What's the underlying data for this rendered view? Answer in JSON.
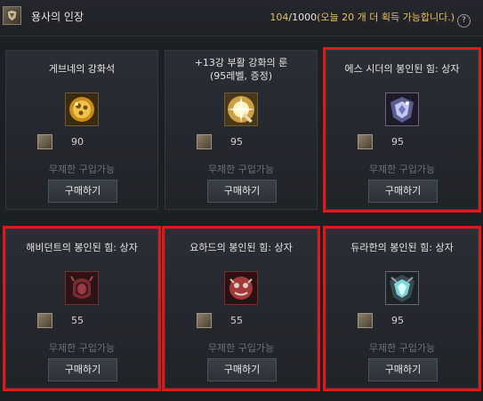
{
  "header": {
    "title": "용사의 인장",
    "count_current": "104",
    "count_max": "/1000",
    "count_note": "(오늘 20 개 더 획득 가능합니다.)",
    "help_label": "?"
  },
  "colors": {
    "highlight": "#e01818",
    "gold_text": "#e8c15a",
    "card_bg": "#26292f"
  },
  "items": [
    {
      "name": "게브네의 강화석",
      "icon": "golden-orb-icon",
      "price": "90",
      "availability": "무제한 구입가능",
      "buy_label": "구매하기",
      "highlighted": false
    },
    {
      "name_line1": "+13강 부활 강화의 룬",
      "name_line2": "(95레벨, 증정)",
      "icon": "radiant-rune-icon",
      "price": "95",
      "availability": "무제한 구입가능",
      "buy_label": "구매하기",
      "highlighted": false
    },
    {
      "name": "에스 시더의 봉인된 힘: 상자",
      "icon": "sealed-crest-icon",
      "price": "95",
      "availability": "무제한 구입가능",
      "buy_label": "구매하기",
      "highlighted": true
    },
    {
      "name": "해비던트의 봉인된 힘: 상자",
      "icon": "red-helm-icon",
      "price": "55",
      "availability": "무제한 구입가능",
      "buy_label": "구매하기",
      "highlighted": true
    },
    {
      "name": "요하드의 봉인된 힘: 상자",
      "icon": "demon-face-icon",
      "price": "55",
      "availability": "무제한 구입가능",
      "buy_label": "구매하기",
      "highlighted": true
    },
    {
      "name": "듀라한의 봉인된 힘: 상자",
      "icon": "teal-crest-icon",
      "price": "95",
      "availability": "무제한 구입가능",
      "buy_label": "구매하기",
      "highlighted": true
    }
  ]
}
